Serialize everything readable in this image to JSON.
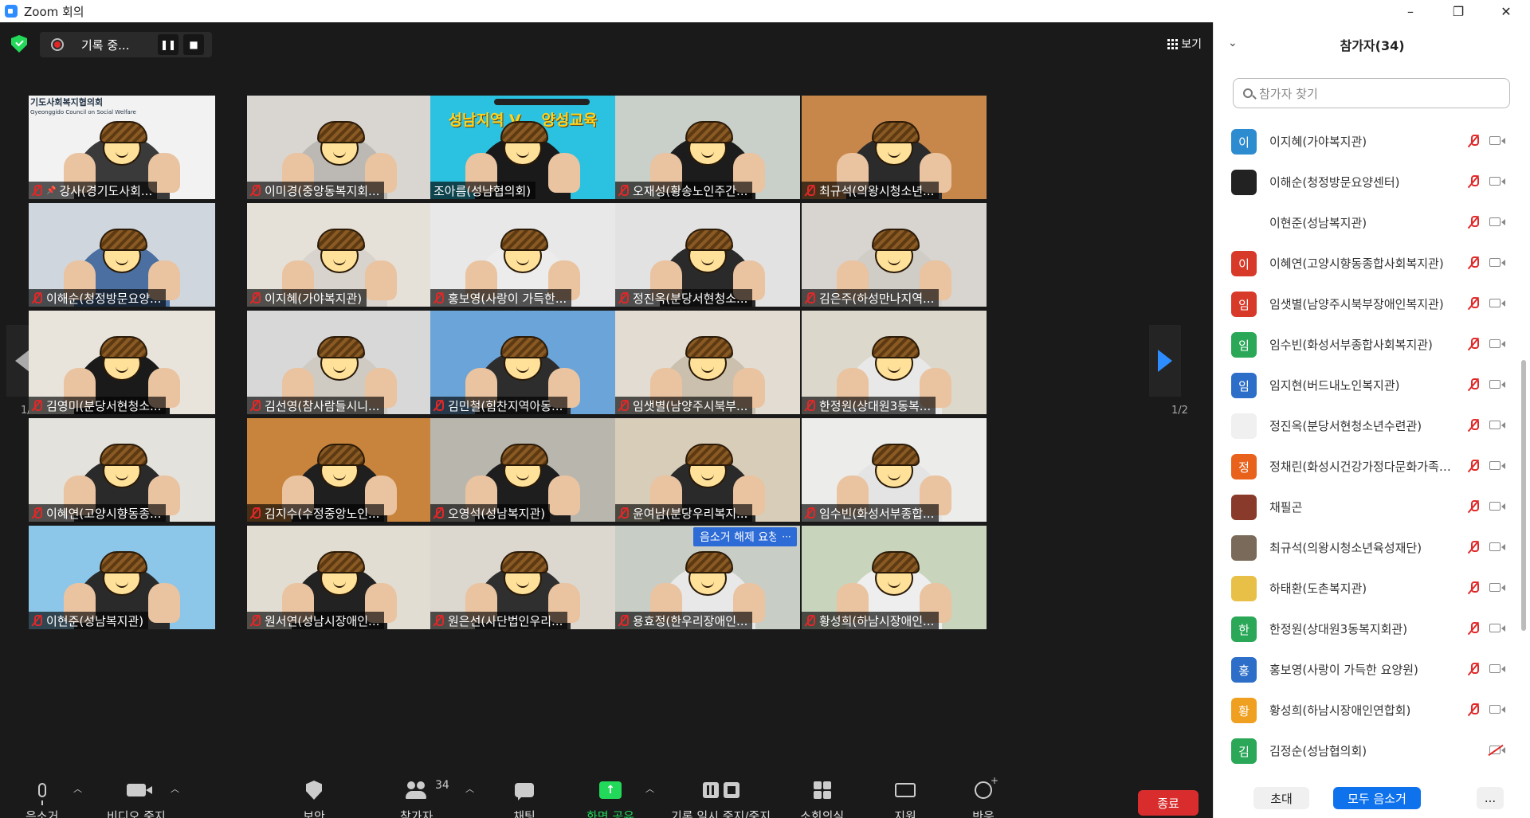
{
  "window": {
    "title": "Zoom 회의",
    "minimize": "–",
    "restore": "❐",
    "close": "✕"
  },
  "topbar": {
    "record_status": "기록 중...",
    "view_label": "보기"
  },
  "pagination": {
    "left": "1/2",
    "right": "1/2"
  },
  "tiles": [
    {
      "name": "강사(경기도사회...",
      "muted": true,
      "bg": "#f2f2f2",
      "shirt": "#3a3a3a",
      "active": true
    },
    {
      "name": "이미경(중앙동복지회...",
      "muted": true,
      "bg": "#d9d6d2",
      "shirt": "#bcb8b4"
    },
    {
      "name": "조아름(성남협의회)",
      "muted": false,
      "bg": "#2ac2e0",
      "shirt": "#1a1a1a",
      "banner": "성남지역 V... 양성교육"
    },
    {
      "name": "오재성(황송노인주간...",
      "muted": true,
      "bg": "#c9cfc9",
      "shirt": "#1c1c1c"
    },
    {
      "name": "최규석(의왕시청소년...",
      "muted": true,
      "bg": "#c8874a",
      "shirt": "#2b2b2b"
    },
    {
      "name": "이해순(청정방문요양...",
      "muted": true,
      "bg": "#cfd6de",
      "shirt": "#4a6fa0"
    },
    {
      "name": "이지혜(가야복지관)",
      "muted": true,
      "bg": "#e6e1d8",
      "shirt": "#d8d3cc"
    },
    {
      "name": "홍보영(사랑이 가득한...",
      "muted": true,
      "bg": "#e8e8e8",
      "shirt": "#ececec"
    },
    {
      "name": "정진옥(분당서현청소...",
      "muted": true,
      "bg": "#e2e2e2",
      "shirt": "#2a2a2a"
    },
    {
      "name": "김은주(하성만나지역...",
      "muted": true,
      "bg": "#d8d4d0",
      "shirt": "#d0ccc6"
    },
    {
      "name": "김영미(분당서현청소...",
      "muted": true,
      "bg": "#e8e4dc",
      "shirt": "#1a1a1a"
    },
    {
      "name": "김선영(참사람들시니...",
      "muted": true,
      "bg": "#d8d8d8",
      "shirt": "#cfcac2"
    },
    {
      "name": "김민철(힘찬지역아동...",
      "muted": true,
      "bg": "#6aa4d8",
      "shirt": "#2d2d2d"
    },
    {
      "name": "임샛별(남양주시북부...",
      "muted": true,
      "bg": "#e2dcd2",
      "shirt": "#cbbfae"
    },
    {
      "name": "한정원(상대원3동복...",
      "muted": true,
      "bg": "#ddd8cc",
      "shirt": "#e8e8e8"
    },
    {
      "name": "이혜연(고양시향동종...",
      "muted": true,
      "bg": "#e4e2dc",
      "shirt": "#2a2a2a"
    },
    {
      "name": "김지수(수정중앙노인...",
      "muted": true,
      "bg": "#c8843c",
      "shirt": "#1f1f1f"
    },
    {
      "name": "오영석(성남복지관)",
      "muted": true,
      "bg": "#b9b6ae",
      "shirt": "#1e1e1e"
    },
    {
      "name": "윤여남(분당우리복지...",
      "muted": true,
      "bg": "#d8cdb8",
      "shirt": "#2a2a2a"
    },
    {
      "name": "임수빈(화성서부종합...",
      "muted": true,
      "bg": "#ececea",
      "shirt": "#e4e4e4"
    },
    {
      "name": "이현준(성남복지관)",
      "muted": true,
      "bg": "#8cc6e8",
      "shirt": "#2a2a2a"
    },
    {
      "name": "원서연(성남시장애인...",
      "muted": true,
      "bg": "#e2ddd2",
      "shirt": "#222222"
    },
    {
      "name": "원은선(사단법인우리...",
      "muted": true,
      "bg": "#ddd8cf",
      "shirt": "#2f2f2f"
    },
    {
      "name": "용효정(한우리장애인...",
      "muted": true,
      "bg": "#c8cdc6",
      "shirt": "#e8e8e8",
      "unmute_request": "음소거 해제 요청"
    },
    {
      "name": "황성희(하남시장애인...",
      "muted": true,
      "bg": "#c8d4bc",
      "shirt": "#eeeeee"
    }
  ],
  "tile_extras": {
    "org_sign_line1": "기도사회복지협의회",
    "org_sign_line2": "Gyeonggido Council on Social Welfare",
    "more": "···"
  },
  "toolbar": {
    "mute": "음소거",
    "video": "비디오 중지",
    "security": "보안",
    "participants": "참가자",
    "participant_count": "34",
    "chat": "채팅",
    "share": "화면 공유",
    "record": "기록 일시 중지/중지",
    "rooms": "소회의실",
    "support": "지원",
    "reactions": "반응",
    "end": "종료"
  },
  "panel": {
    "title": "참가자(34)",
    "search_placeholder": "참가자 찾기",
    "participants": [
      {
        "name": "이지혜(가야복지관)",
        "avatar": "이",
        "color": "#2d8ccf",
        "muted": true,
        "cam_off": false
      },
      {
        "name": "이해순(청정방문요양센터)",
        "avatar": "",
        "color": "#222222",
        "muted": true,
        "cam_off": false
      },
      {
        "name": "이현준(성남복지관)",
        "avatar": "",
        "color": "#ffffff",
        "muted": true,
        "cam_off": false
      },
      {
        "name": "이혜연(고양시향동종합사회복지관)",
        "avatar": "이",
        "color": "#d83a2a",
        "muted": true,
        "cam_off": false
      },
      {
        "name": "임샛별(남양주시북부장애인복지관)",
        "avatar": "임",
        "color": "#d83a2a",
        "muted": true,
        "cam_off": false
      },
      {
        "name": "임수빈(화성서부종합사회복지관)",
        "avatar": "임",
        "color": "#2aa858",
        "muted": true,
        "cam_off": false
      },
      {
        "name": "임지현(버드내노인복지관)",
        "avatar": "임",
        "color": "#2d6fc8",
        "muted": true,
        "cam_off": false
      },
      {
        "name": "정진옥(분당서현청소년수련관)",
        "avatar": "",
        "color": "#f0f0f0",
        "muted": true,
        "cam_off": false
      },
      {
        "name": "정채린(화성시건강가정다문화가족지원센터)",
        "avatar": "정",
        "color": "#e8621c",
        "muted": true,
        "cam_off": false
      },
      {
        "name": "채필곤",
        "avatar": "",
        "color": "#8a3a2a",
        "muted": true,
        "cam_off": false
      },
      {
        "name": "최규석(의왕시청소년육성재단)",
        "avatar": "",
        "color": "#7a6a5a",
        "muted": true,
        "cam_off": false
      },
      {
        "name": "하태환(도촌복지관)",
        "avatar": "",
        "color": "#e8c048",
        "muted": true,
        "cam_off": false
      },
      {
        "name": "한정원(상대원3동복지회관)",
        "avatar": "한",
        "color": "#2aa858",
        "muted": true,
        "cam_off": false
      },
      {
        "name": "홍보영(사랑이 가득한 요양원)",
        "avatar": "홍",
        "color": "#2d6fc8",
        "muted": true,
        "cam_off": false
      },
      {
        "name": "황성희(하남시장애인연합회)",
        "avatar": "황",
        "color": "#f0a020",
        "muted": true,
        "cam_off": false
      },
      {
        "name": "김정순(성남협의회)",
        "avatar": "김",
        "color": "#2aa858",
        "muted": false,
        "cam_off": true
      }
    ],
    "invite": "초대",
    "mute_all": "모두 음소거",
    "more": "..."
  }
}
